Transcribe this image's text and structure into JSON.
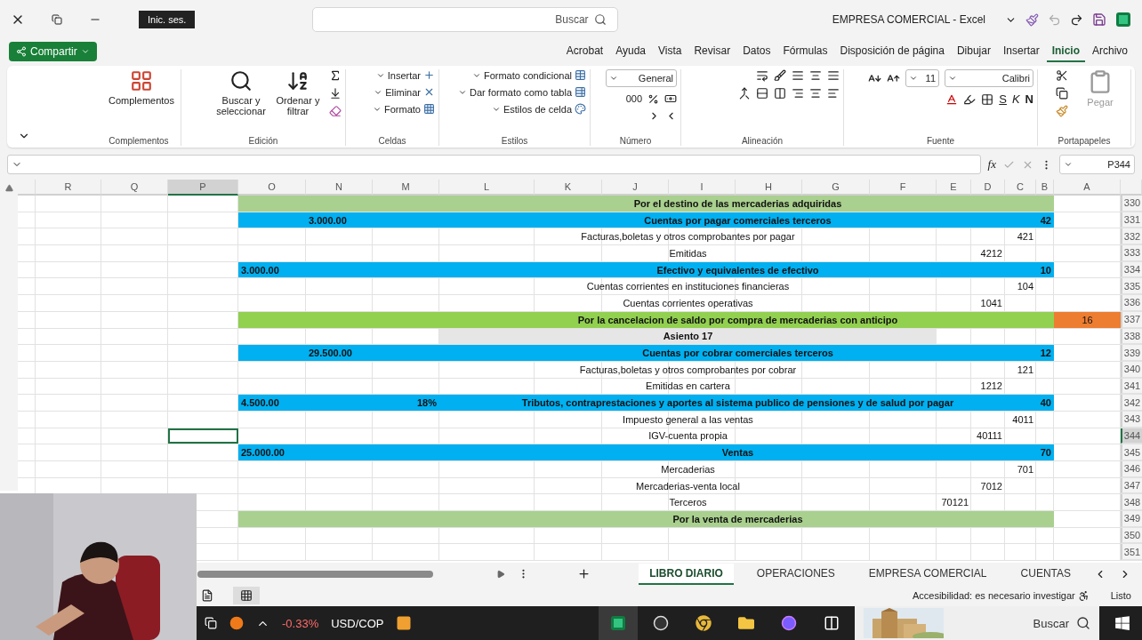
{
  "title_bar": {
    "title": "EMPRESA COMERCIAL  -  Excel",
    "search": {
      "placeholder": "Buscar"
    },
    "sign_in": "Inic. ses."
  },
  "menu": {
    "tabs": [
      {
        "label": "Acrobat",
        "selected": false
      },
      {
        "label": "Ayuda",
        "selected": false
      },
      {
        "label": "Vista",
        "selected": false
      },
      {
        "label": "Revisar",
        "selected": false
      },
      {
        "label": "Datos",
        "selected": false
      },
      {
        "label": "Fórmulas",
        "selected": false
      },
      {
        "label": "Disposición de página",
        "selected": false
      },
      {
        "label": "Dibujar",
        "selected": false
      },
      {
        "label": "Insertar",
        "selected": false
      },
      {
        "label": "Inicio",
        "selected": true
      },
      {
        "label": "Archivo",
        "selected": false
      }
    ],
    "share": "Compartir"
  },
  "ribbon": {
    "groups": [
      {
        "kind": "large",
        "label": "Complementos",
        "items": [
          "Complementos"
        ]
      },
      {
        "kind": "editing",
        "label": "Edición",
        "items": [
          "Buscar y seleccionar",
          "Ordenar y filtrar"
        ]
      },
      {
        "kind": "cells",
        "label": "Celdas",
        "items": [
          "Insertar",
          "Eliminar",
          "Formato"
        ]
      },
      {
        "kind": "list",
        "label": "Estilos",
        "items": [
          "Formato condicional",
          "Dar formato como tabla",
          "Estilos de celda"
        ]
      },
      {
        "kind": "number",
        "label": "Número",
        "format": "General",
        "thousands": "000"
      },
      {
        "kind": "alignment",
        "label": "Alineación"
      },
      {
        "kind": "font",
        "label": "Fuente",
        "font": "Calibri",
        "size": "11",
        "bold": "N",
        "italic": "K",
        "underline": "S"
      },
      {
        "kind": "clipboard",
        "label": "Portapapeles",
        "paste": "Pegar"
      }
    ]
  },
  "formula_bar": {
    "name_box": "P344",
    "function_label": "fx"
  },
  "columns": [
    {
      "label": "R",
      "selected": false
    },
    {
      "label": "Q",
      "selected": false
    },
    {
      "label": "P",
      "selected": true
    },
    {
      "label": "O",
      "selected": false
    },
    {
      "label": "N",
      "selected": false
    },
    {
      "label": "M",
      "selected": false
    },
    {
      "label": "L",
      "selected": false
    },
    {
      "label": "K",
      "selected": false
    },
    {
      "label": "J",
      "selected": false
    },
    {
      "label": "I",
      "selected": false
    },
    {
      "label": "H",
      "selected": false
    },
    {
      "label": "G",
      "selected": false
    },
    {
      "label": "F",
      "selected": false
    },
    {
      "label": "E",
      "selected": false
    },
    {
      "label": "D",
      "selected": false
    },
    {
      "label": "C",
      "selected": false
    },
    {
      "label": "B",
      "selected": false
    },
    {
      "label": "A",
      "selected": false
    }
  ],
  "rows": [
    {
      "row": "330",
      "kind": "title",
      "color": "#a9d08e",
      "title": "Por el destino de las mercaderias adquiridas",
      "selected": false
    },
    {
      "row": "331",
      "kind": "account",
      "color": "#00b0f0",
      "account": "42",
      "title": "Cuentas por pagar comerciales terceros",
      "debit": "3.000.00",
      "selected": false
    },
    {
      "row": "332",
      "kind": "subaccount",
      "account": "421",
      "title": "Facturas,boletas y otros comprobantes por pagar",
      "selected": false
    },
    {
      "row": "333",
      "kind": "divisionary",
      "account": "4212",
      "title": "Emitidas",
      "selected": false
    },
    {
      "row": "334",
      "kind": "account",
      "color": "#00b0f0",
      "account": "10",
      "title": "Efectivo y equivalentes de efectivo",
      "credit": "3.000.00",
      "selected": false
    },
    {
      "row": "335",
      "kind": "subaccount",
      "account": "104",
      "title": "Cuentas corrientes en instituciones financieras",
      "selected": false
    },
    {
      "row": "336",
      "kind": "divisionary",
      "account": "1041",
      "title": "Cuentas corrientes operativas",
      "selected": false
    },
    {
      "row": "337",
      "kind": "title",
      "color": "#92d050",
      "marker": {
        "text": "16",
        "color": "#ed7d31"
      },
      "title": "Por la cancelacion de saldo por compra de mercaderias con anticipo",
      "selected": false
    },
    {
      "row": "338",
      "kind": "heading",
      "title": "Asiento 17",
      "selected": false
    },
    {
      "row": "339",
      "kind": "account",
      "color": "#00b0f0",
      "account": "12",
      "title": "Cuentas por cobrar comerciales terceros",
      "debit": "29.500.00",
      "selected": false
    },
    {
      "row": "340",
      "kind": "subaccount",
      "account": "121",
      "title": "Facturas,boletas y otros comprobantes por cobrar",
      "selected": false
    },
    {
      "row": "341",
      "kind": "divisionary",
      "account": "1212",
      "title": "Emitidas en cartera",
      "selected": false
    },
    {
      "row": "342",
      "kind": "account",
      "color": "#00b0f0",
      "account": "40",
      "title": "Tributos, contraprestaciones y aportes al sistema publico de pensiones y de salud por pagar",
      "rate": "18%",
      "credit": "4.500.00",
      "selected": false
    },
    {
      "row": "343",
      "kind": "subaccount",
      "account": "4011",
      "title": "Impuesto general a las ventas",
      "selected": false
    },
    {
      "row": "344",
      "kind": "divisionary",
      "account": "40111",
      "title": "IGV-cuenta propia",
      "selected": true
    },
    {
      "row": "345",
      "kind": "account",
      "color": "#00b0f0",
      "account": "70",
      "title": "Ventas",
      "credit": "25.000.00",
      "selected": false
    },
    {
      "row": "346",
      "kind": "subaccount",
      "account": "701",
      "title": "Mercaderias",
      "selected": false
    },
    {
      "row": "347",
      "kind": "divisionary",
      "account": "7012",
      "title": "Mercaderias-venta local",
      "selected": false
    },
    {
      "row": "348",
      "kind": "subdivisionary",
      "account": "70121",
      "title": "Terceros",
      "selected": false
    },
    {
      "row": "349",
      "kind": "title",
      "color": "#a9d08e",
      "title": "Por la venta de mercaderias",
      "selected": false
    },
    {
      "row": "350",
      "kind": "empty",
      "selected": false
    },
    {
      "row": "351",
      "kind": "empty",
      "selected": false
    }
  ],
  "sheet_tabs": [
    {
      "label": "LIBRO DIARIO",
      "selected": true
    },
    {
      "label": "OPERACIONES",
      "selected": false
    },
    {
      "label": "EMPRESA COMERCIAL",
      "selected": false
    },
    {
      "label": "CUENTAS",
      "selected": false
    }
  ],
  "status_bar": {
    "state": "Listo",
    "accessibility": "Accesibilidad: es necesario investigar"
  },
  "taskbar": {
    "search": "Buscar",
    "ticker": {
      "symbol": "USD/COP",
      "change": "-0.33%"
    }
  }
}
